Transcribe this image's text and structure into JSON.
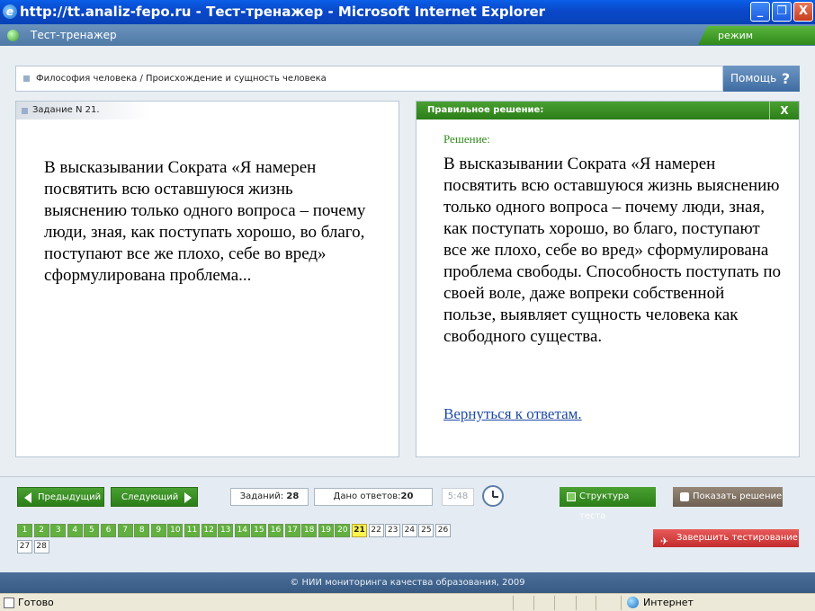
{
  "window": {
    "title": "http://tt.analiz-fepo.ru - Тест-тренажер - Microsoft Internet Explorer",
    "minimize_glyph": "_",
    "maximize_glyph": "❐",
    "close_glyph": "X"
  },
  "app": {
    "name": "Тест-тренажер",
    "mode": "режим \"Обучение\""
  },
  "breadcrumb": "Философия человека / Происхождение и сущность человека",
  "help": {
    "label": "Помощь",
    "glyph": "?"
  },
  "task": {
    "header": "Задание N 21.",
    "text": "В высказывании Сократа «Я намерен посвятить всю оставшуюся жизнь выяснению только одного вопроса – почему люди, зная, как поступать хорошо, во благо, поступают все же плохо, себе во вред» сформулирована проблема..."
  },
  "solution_panel": {
    "header": "Правильное решение:",
    "close_glyph": "X",
    "label": "Решение:",
    "text": "В высказывании Сократа «Я намерен посвятить всю оставшуюся жизнь выяснению только одного вопроса – почему люди, зная, как поступать хорошо, во благо, поступают все же плохо, себе во вред» сформулирована проблема свободы. Способность поступать по своей воле, даже вопреки собственной пользе, выявляет сущность человека как свободного существа.",
    "back_link": "Вернуться к ответам."
  },
  "toolbar": {
    "prev": "Предыдущий",
    "next": "Следующий",
    "tasks_label": "Заданий:",
    "tasks_count": "28",
    "answers_label": "Дано ответов:",
    "answers_count": "20",
    "time": "5:48",
    "structure": "Структура теста",
    "show_solution": "Показать решение",
    "finish": "Завершить тестирование"
  },
  "questions": {
    "answered": [
      "1",
      "2",
      "3",
      "4",
      "5",
      "6",
      "7",
      "8",
      "9",
      "10",
      "11",
      "12",
      "13",
      "14",
      "15",
      "16",
      "17",
      "18",
      "19",
      "20"
    ],
    "current": "21",
    "open": [
      "22",
      "23",
      "24",
      "25",
      "26",
      "27",
      "28"
    ]
  },
  "footer": "© НИИ мониторинга качества образования, 2009",
  "statusbar": {
    "left": "Готово",
    "zone": "Интернет"
  },
  "colors": {
    "accent_green": "#2b7e18",
    "current_question": "#fff44f",
    "finish_red": "#c42c2c"
  }
}
